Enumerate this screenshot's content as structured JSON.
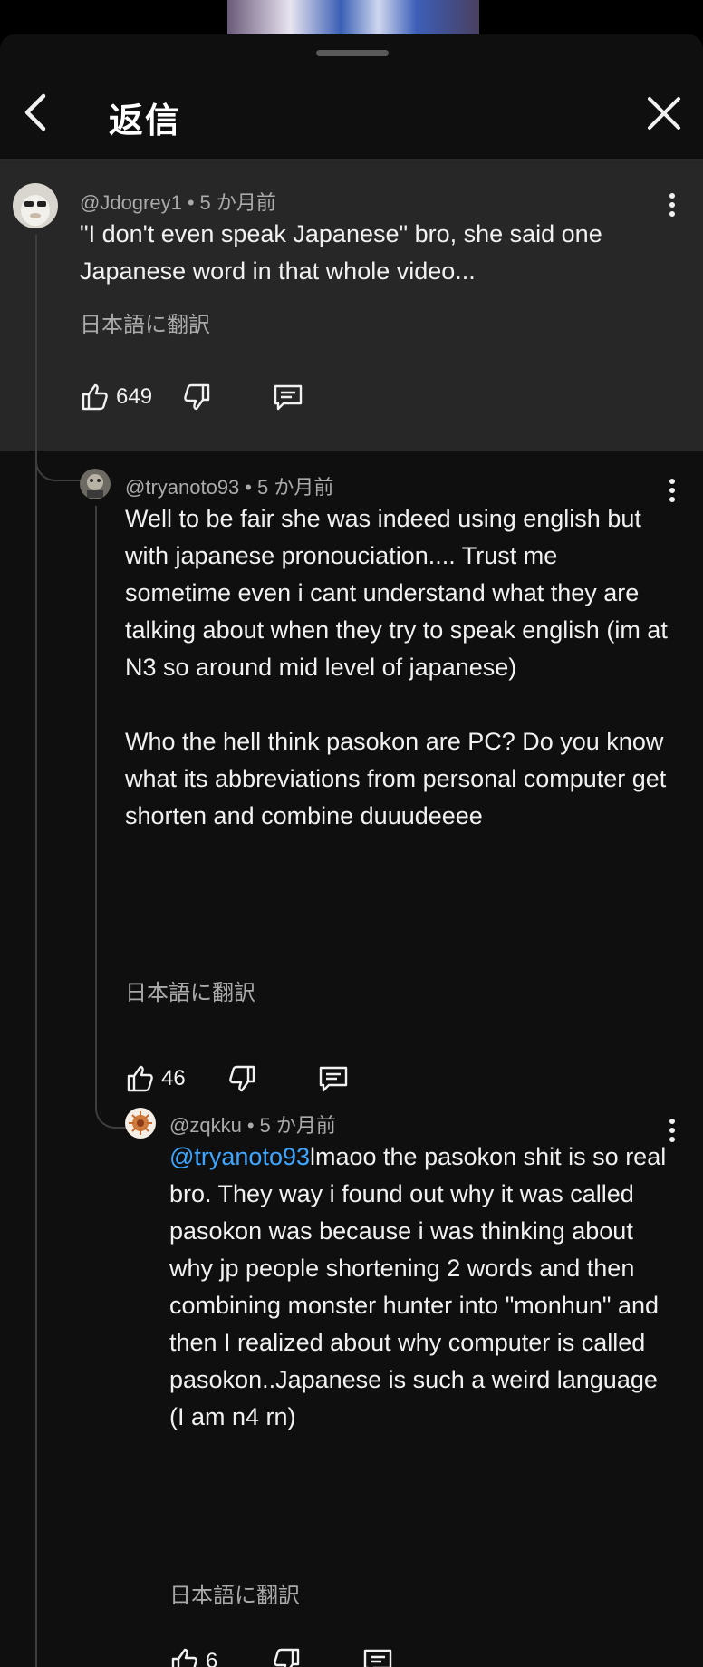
{
  "header": {
    "title": "返信"
  },
  "comments": [
    {
      "handle": "@Jdogrey1",
      "time": "5 か月前",
      "text": "\"I don't even speak Japanese\" bro, she said one Japanese word in that whole video...",
      "translate": "日本語に翻訳",
      "likes": "649"
    },
    {
      "handle": "@tryanoto93",
      "time": "5 か月前",
      "text": "Well to be fair she was indeed using english but with japanese pronouciation.... Trust me sometime even i cant understand what they are talking about when they try to speak english (im at N3 so around mid level of japanese)\n\nWho the hell think pasokon are PC? Do you know what its abbreviations from personal computer get shorten and combine duuudeeee",
      "translate": "日本語に翻訳",
      "likes": "46"
    },
    {
      "handle": "@zqkku",
      "time": "5 か月前",
      "mention": "@tryanoto93",
      "text": "lmaoo the pasokon shit is so real bro. They way i found out why it was called pasokon was because i was thinking about why jp people shortening 2 words and then combining monster hunter into \"monhun\" and then I realized about why computer is called pasokon..Japanese is such a weird language (I am n4 rn)",
      "translate": "日本語に翻訳",
      "likes": "6"
    }
  ],
  "colors": {
    "background": "#0f0f0f",
    "parent_highlight": "#272727",
    "mention": "#3ea6ff",
    "secondary_text": "#aaaaaa"
  }
}
